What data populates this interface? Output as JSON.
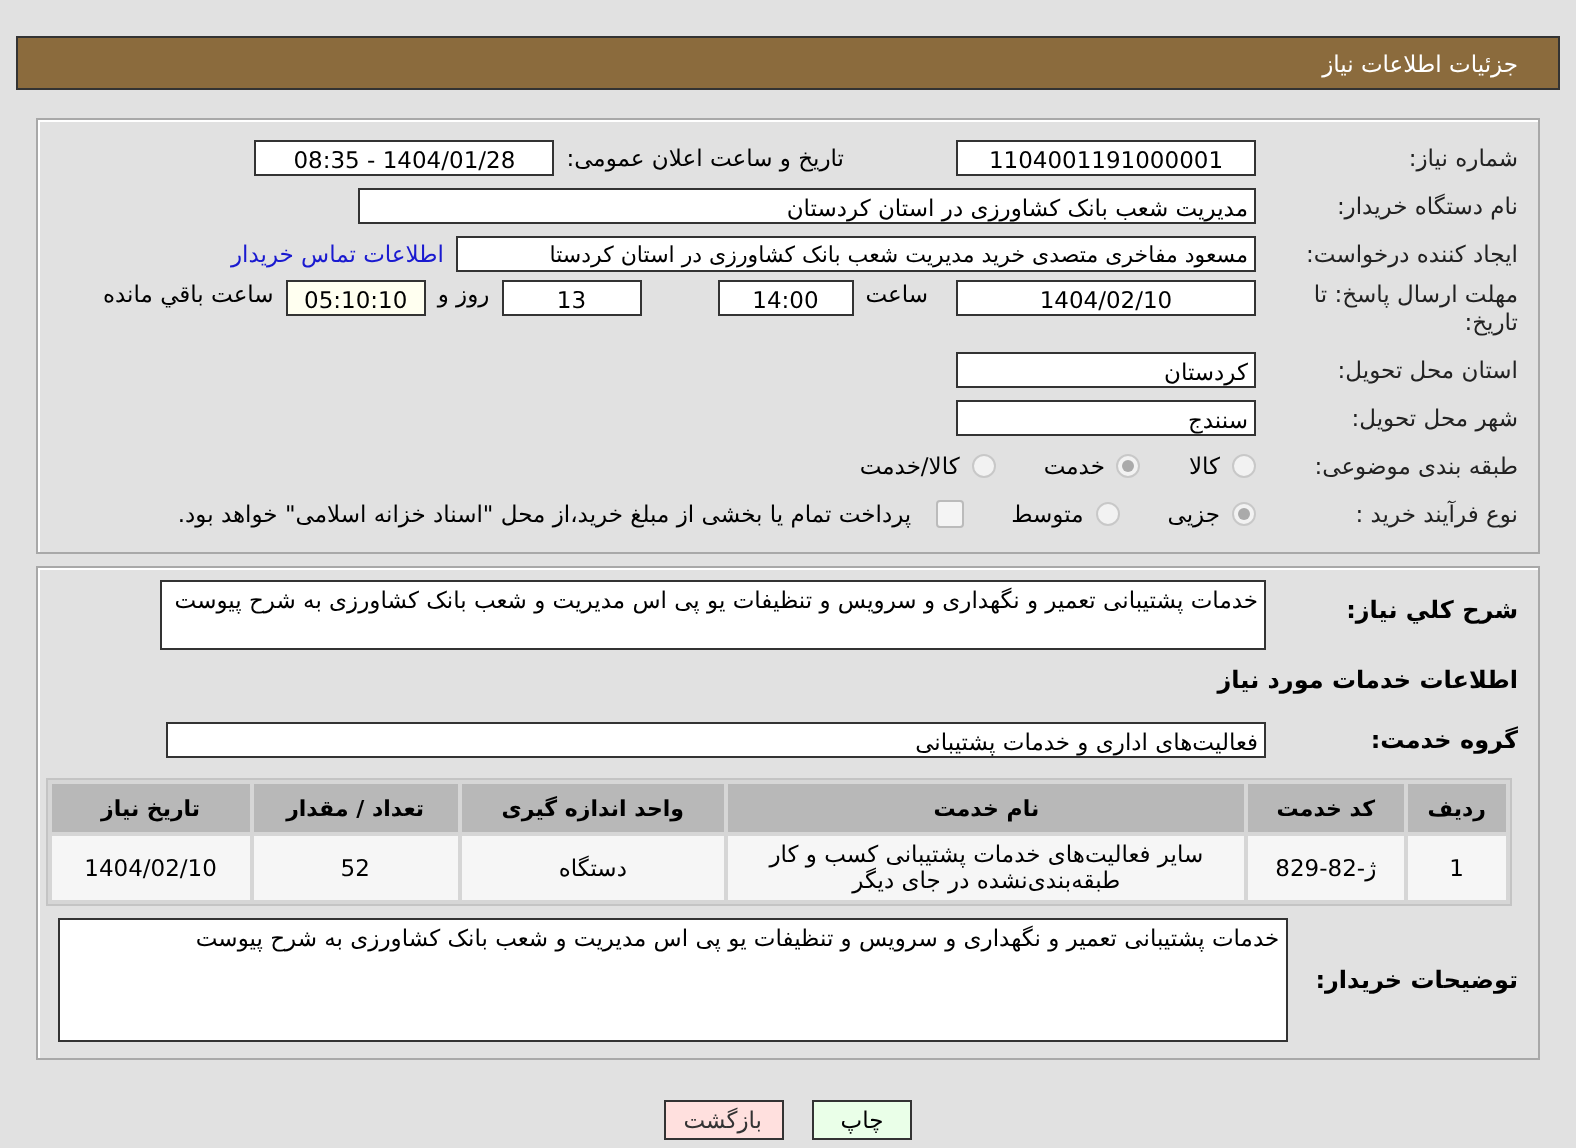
{
  "header": {
    "title": "جزئیات اطلاعات نیاز"
  },
  "need_info": {
    "need_number": {
      "label": "شماره نیاز:",
      "value": "1104001191000001"
    },
    "announce": {
      "label": "تاریخ و ساعت اعلان عمومی:",
      "value": "1404/01/28 - 08:35"
    },
    "buyer": {
      "label": "نام دستگاه خریدار:",
      "value": "مدیریت شعب بانک کشاورزی در استان کردستان"
    },
    "creator": {
      "label": "ایجاد کننده درخواست:",
      "value": "مسعود  مفاخری  متصدی خرید  مدیریت شعب بانک کشاورزی در استان کردستا",
      "link": "اطلاعات تماس خریدار"
    },
    "deadline": {
      "label": "مهلت ارسال پاسخ: تا تاریخ:",
      "date": "1404/02/10",
      "time_label": "ساعت",
      "time": "14:00",
      "days": "13",
      "days_label": "روز و",
      "remaining": "05:10:10",
      "remaining_label": "ساعت باقي مانده"
    },
    "province": {
      "label": "استان محل تحویل:",
      "value": "کردستان"
    },
    "city": {
      "label": "شهر محل تحویل:",
      "value": "سنندج"
    },
    "category": {
      "label": "طبقه بندی موضوعی:",
      "options": [
        {
          "label": "کالا",
          "selected": false
        },
        {
          "label": "خدمت",
          "selected": true
        },
        {
          "label": "کالا/خدمت",
          "selected": false
        }
      ]
    },
    "process": {
      "label": "نوع فرآیند خرید :",
      "options": [
        {
          "label": "جزیی",
          "selected": true
        },
        {
          "label": "متوسط",
          "selected": false
        }
      ],
      "treasury": {
        "checked": false,
        "text": "پرداخت تمام یا بخشی از مبلغ خرید،از محل \"اسناد خزانه اسلامی\" خواهد بود."
      }
    }
  },
  "services": {
    "summary": {
      "label": "شرح کلي نیاز:",
      "value": "خدمات پشتیبانی تعمیر و نگهداری و سرویس و تنظیفات یو پی اس مدیریت و شعب بانک کشاورزی به شرح پیوست"
    },
    "heading": "اطلاعات خدمات مورد نیاز",
    "group": {
      "label": "گروه خدمت:",
      "value": "فعالیت‌های اداری و خدمات پشتیبانی"
    },
    "table": {
      "columns": [
        "ردیف",
        "کد خدمت",
        "نام خدمت",
        "واحد اندازه گیری",
        "تعداد / مقدار",
        "تاریخ نیاز"
      ],
      "rows": [
        [
          "1",
          "ژ-82-829",
          "سایر فعالیت‌های خدمات پشتیبانی کسب و کار طبقه‌بندی‌نشده در جای دیگر",
          "دستگاه",
          "52",
          "1404/02/10"
        ]
      ]
    },
    "notes": {
      "label": "توضیحات خریدار:",
      "value": "خدمات پشتیبانی تعمیر و نگهداری و سرویس و تنظیفات یو پی اس مدیریت و شعب بانک کشاورزی به شرح پیوست"
    }
  },
  "buttons": [
    {
      "kind": "print",
      "label": "چاپ"
    },
    {
      "kind": "back",
      "label": "بازگشت"
    }
  ]
}
